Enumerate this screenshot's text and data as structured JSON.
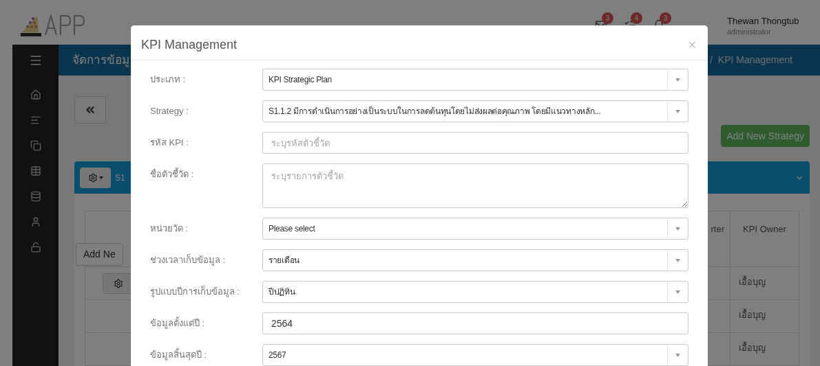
{
  "header": {
    "user_name": "Thewan Thongtub",
    "user_role": "administrator",
    "badges": [
      {
        "count": "3"
      },
      {
        "count": "4"
      },
      {
        "count": "3"
      }
    ]
  },
  "navbar": {
    "title": "จัดการข้อมู",
    "breadcrumb": "/  KPI Management"
  },
  "content": {
    "add_button": "Add New Strategy",
    "panel_title": "S1",
    "table": {
      "column_cut": "rter",
      "column_owner": "KPI Owner",
      "add_button": "Add Ne",
      "rows": [
        {
          "owner": "เอื้อบุญ"
        },
        {
          "owner": "เอื้อบุญ"
        },
        {
          "owner": "เอื้อบุญ"
        }
      ]
    }
  },
  "modal": {
    "title": "KPI Management",
    "close": "×",
    "fields": [
      {
        "label": "ประเภท :",
        "kind": "select",
        "value": "KPI Strategic Plan"
      },
      {
        "label": "Strategy :",
        "kind": "select",
        "value": "S1.1.2 มีการดำเนินการอย่างเป็นระบบในการลดต้นทุนโดยไม่ส่งผลต่อคุณภาพ โดยมีแนวทางหลัก..."
      },
      {
        "label": "รหัส KPI :",
        "kind": "input",
        "placeholder": "ระบุรหัสตัวชี้วัด"
      },
      {
        "label": "ชื่อตัวชี้วัด :",
        "kind": "textarea",
        "placeholder": "ระบุรายการตัวชี้วัด"
      },
      {
        "label": "หน่วยวัด :",
        "kind": "select",
        "value": "Please select"
      },
      {
        "label": "ช่วงเวลาเก็บข้อมูล :",
        "kind": "select",
        "value": "รายเดือน"
      },
      {
        "label": "รูปแบบปีการเก็บข้อมูล :",
        "kind": "select",
        "value": "ปีปฏิทิน"
      },
      {
        "label": "ข้อมูลตั้งแต่ปี :",
        "kind": "input",
        "value": "2564"
      },
      {
        "label": "ข้อมูลสิ้นสุดปี :",
        "kind": "select",
        "value": "2567"
      }
    ]
  }
}
